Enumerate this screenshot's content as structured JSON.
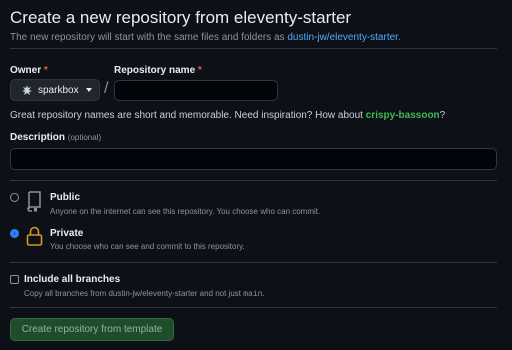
{
  "page": {
    "title": "Create a new repository from eleventy-starter",
    "subtitle_prefix": "The new repository will start with the same files and folders as ",
    "template_link": "dustin-jw/eleventy-starter",
    "subtitle_suffix": "."
  },
  "owner": {
    "label": "Owner",
    "required_mark": "*",
    "selected": "sparkbox"
  },
  "separator": "/",
  "repo_name": {
    "label": "Repository name",
    "required_mark": "*",
    "value": "",
    "placeholder": ""
  },
  "name_hint": {
    "text": "Great repository names are short and memorable. Need inspiration? How about ",
    "suggestion": "crispy-bassoon",
    "suffix": "?"
  },
  "description": {
    "label": "Description",
    "optional": "(optional)",
    "value": ""
  },
  "visibility": {
    "public": {
      "title": "Public",
      "description": "Anyone on the internet can see this repository. You choose who can commit.",
      "checked": false
    },
    "private": {
      "title": "Private",
      "description": "You choose who can see and commit to this repository.",
      "checked": true
    }
  },
  "branches": {
    "title": "Include all branches",
    "description_prefix": "Copy all branches from dustin-jw/eleventy-starter and not just ",
    "description_code": "main",
    "description_suffix": ".",
    "checked": false
  },
  "submit_label": "Create repository from template",
  "colors": {
    "background": "#0d1117",
    "link": "#58a6ff",
    "success_text": "#3fb950",
    "radio_checked": "#2f81f7",
    "private_lock": "#d29922",
    "submit_bg": "#1f4d2b"
  }
}
